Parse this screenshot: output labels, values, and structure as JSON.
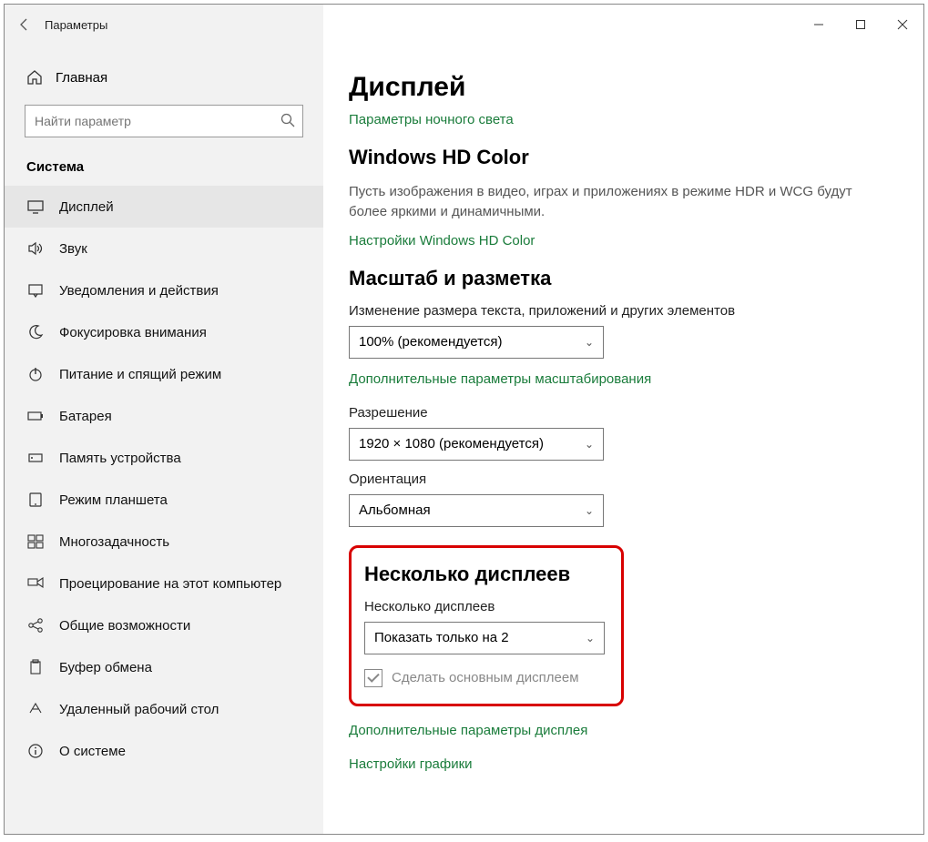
{
  "window": {
    "title": "Параметры"
  },
  "sidebar": {
    "home": "Главная",
    "search_placeholder": "Найти параметр",
    "group": "Система",
    "items": [
      {
        "label": "Дисплей"
      },
      {
        "label": "Звук"
      },
      {
        "label": "Уведомления и действия"
      },
      {
        "label": "Фокусировка внимания"
      },
      {
        "label": "Питание и спящий режим"
      },
      {
        "label": "Батарея"
      },
      {
        "label": "Память устройства"
      },
      {
        "label": "Режим планшета"
      },
      {
        "label": "Многозадачность"
      },
      {
        "label": "Проецирование на этот компьютер"
      },
      {
        "label": "Общие возможности"
      },
      {
        "label": "Буфер обмена"
      },
      {
        "label": "Удаленный рабочий стол"
      },
      {
        "label": "О системе"
      }
    ]
  },
  "main": {
    "title": "Дисплей",
    "night_light_link": "Параметры ночного света",
    "hd_heading": "Windows HD Color",
    "hd_body": "Пусть изображения в видео, играх и приложениях в режиме HDR и WCG будут более яркими и динамичными.",
    "hd_link": "Настройки Windows HD Color",
    "scale_heading": "Масштаб и разметка",
    "scale_label": "Изменение размера текста, приложений и других элементов",
    "scale_value": "100% (рекомендуется)",
    "scale_link": "Дополнительные параметры масштабирования",
    "resolution_label": "Разрешение",
    "resolution_value": "1920 × 1080 (рекомендуется)",
    "orientation_label": "Ориентация",
    "orientation_value": "Альбомная",
    "multi_heading": "Несколько дисплеев",
    "multi_label": "Несколько дисплеев",
    "multi_value": "Показать только на 2",
    "primary_checkbox": "Сделать основным дисплеем",
    "adv_display_link": "Дополнительные параметры дисплея",
    "graphics_link": "Настройки графики"
  }
}
